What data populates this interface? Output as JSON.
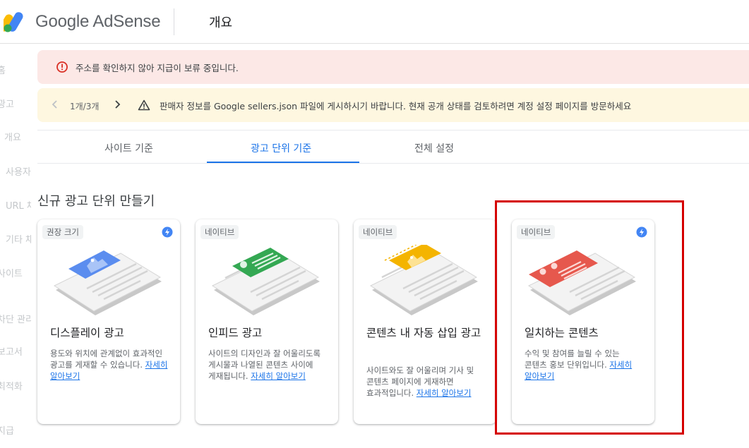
{
  "header": {
    "brand": "Google AdSense",
    "page_title": "개요"
  },
  "sidenav": [
    {
      "label": "홈"
    },
    {
      "label": "광고"
    },
    {
      "label": "개요"
    },
    {
      "label": "사용자설정 채널"
    },
    {
      "label": "URL 채널"
    },
    {
      "label": "기타 채널"
    },
    {
      "label": "사이트"
    },
    {
      "label": "차단 관리"
    },
    {
      "label": "보고서"
    },
    {
      "label": "최적화"
    },
    {
      "label": "지급"
    }
  ],
  "banners": {
    "error_text": "주소를 확인하지 않아 지급이 보류 중입니다.",
    "pager_text": "1개/3개",
    "warning_text": "판매자 정보를 Google sellers.json 파일에 게시하시기 바랍니다. 현재 공개 상태를 검토하려면 계정 설정 페이지를 방문하세요"
  },
  "tabs": [
    {
      "label": "사이트 기준"
    },
    {
      "label": "광고 단위 기준"
    },
    {
      "label": "전체 설정"
    }
  ],
  "section_title": "신규 광고 단위 만들기",
  "cards": [
    {
      "chip": "권장 크기",
      "title": "디스플레이 광고",
      "desc": "용도와 위치에 관계없이 효과적인 광고를 게재할 수 있습니다.",
      "link": "자세히 알아보기"
    },
    {
      "chip": "네이티브",
      "title": "인피드 광고",
      "desc": "사이트의 디자인과 잘 어울리도록 게시물과 나열된 콘텐츠 사이에 게재됩니다.",
      "link": "자세히 알아보기"
    },
    {
      "chip": "네이티브",
      "title": "콘텐츠 내 자동 삽입 광고",
      "desc": "사이트와도 잘 어울리며 기사 및 콘텐츠 페이지에 게재하면 효과적입니다.",
      "link": "자세히 알아보기"
    },
    {
      "chip": "네이티브",
      "title": "일치하는 콘텐츠",
      "desc": "수익 및 참여를 늘릴 수 있는 콘텐츠 홍보 단위입니다.",
      "link": "자세히 알아보기"
    }
  ],
  "colors": {
    "accent": "#1a73e8",
    "error_bg": "#fce8e6",
    "warning_bg": "#fef7e0",
    "highlight_border": "#d50000"
  }
}
